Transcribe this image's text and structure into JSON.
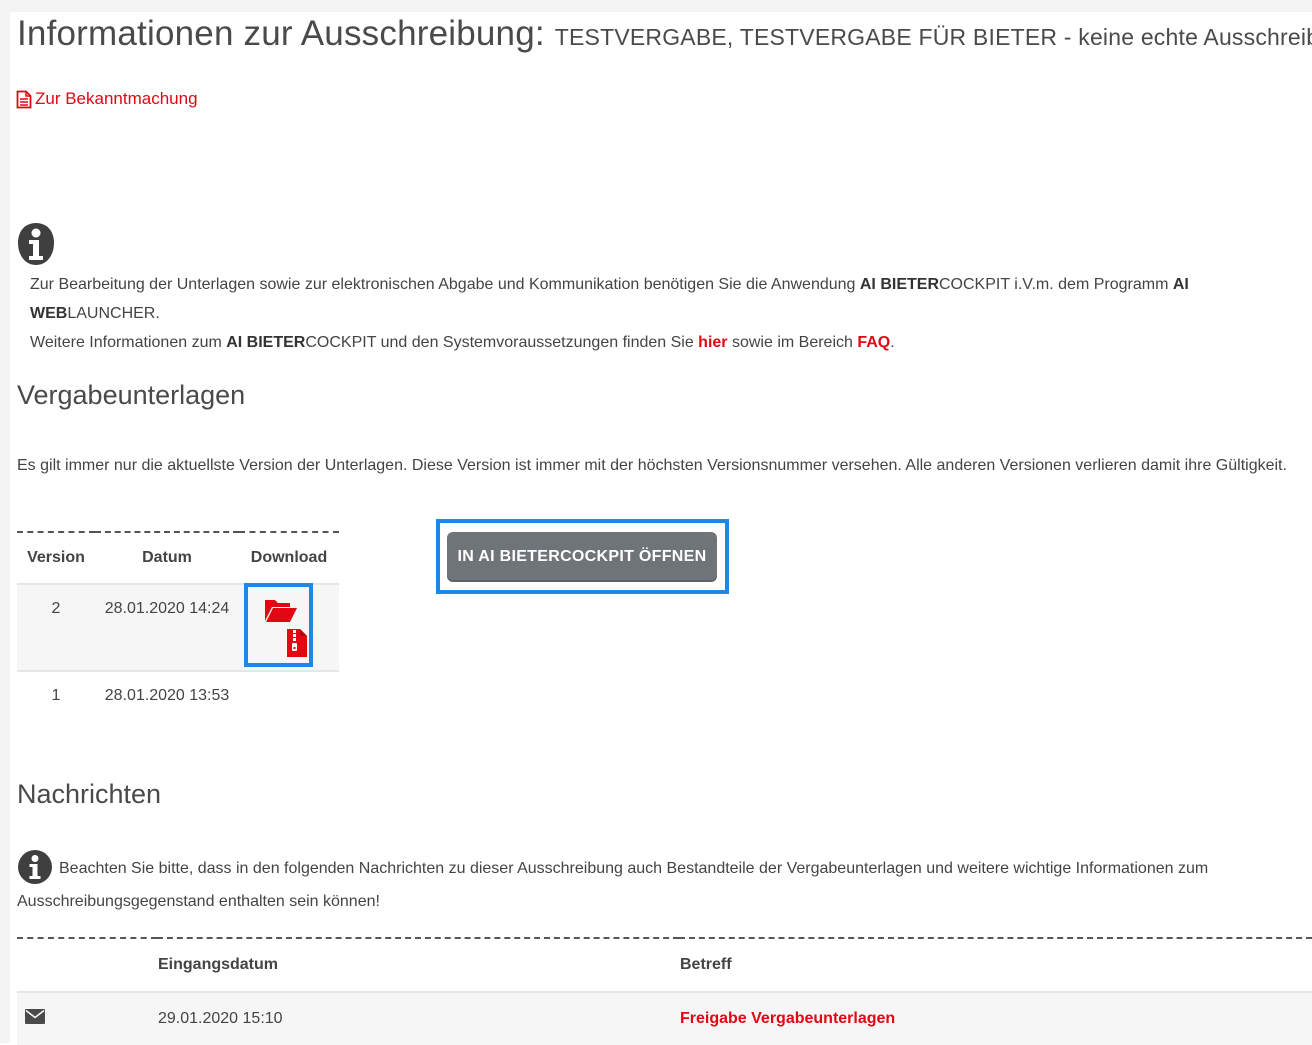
{
  "header": {
    "title": "Informationen zur Ausschreibung:",
    "subtitle": "TESTVERGABE, TESTVERGABE FÜR BIETER - keine echte Ausschreibung!"
  },
  "announcement_link": {
    "label": "Zur Bekanntmachung",
    "icon": "document-icon"
  },
  "info": {
    "icon": "info-icon",
    "p1_a": "Zur Bearbeitung der Unterlagen sowie zur elektronischen Abgabe und Kommunikation benötigen Sie die Anwendung ",
    "p1_ai1": "AI BIETER",
    "p1_cockpit": "COCKPIT",
    "p1_b": " i.V.m. dem Programm ",
    "p1_ai2": "AI WEB",
    "p1_launcher": "LAUNCHER",
    "p1_end": ".",
    "p2_a": "Weitere Informationen zum ",
    "p2_ai": "AI BIETER",
    "p2_cockpit": "COCKPIT",
    "p2_b": " und den Systemvoraussetzungen finden Sie ",
    "p2_link_hier": "hier",
    "p2_c": " sowie im Bereich ",
    "p2_link_faq": "FAQ",
    "p2_end": "."
  },
  "vergabe": {
    "heading": "Vergabeunterlagen",
    "note": "Es gilt immer nur die aktuellste Version der Unterlagen. Diese Version ist immer mit der höchsten Versionsnummer versehen. Alle anderen Versionen verlieren damit ihre Gültigkeit.",
    "columns": [
      "Version",
      "Datum",
      "Download"
    ],
    "rows": [
      {
        "version": "2",
        "datum": "28.01.2020 14:24",
        "download_icons": [
          "folder-open-icon",
          "zip-file-icon"
        ]
      },
      {
        "version": "1",
        "datum": "28.01.2020 13:53",
        "download_icons": []
      }
    ],
    "button_label": "IN AI BIETERCOCKPIT ÖFFNEN",
    "colors": {
      "accent": "#e30613",
      "button": "#6f7479",
      "highlight": "#1e88e5"
    }
  },
  "nachrichten": {
    "heading": "Nachrichten",
    "note": "Beachten Sie bitte, dass in den folgenden Nachrichten zu dieser Ausschreibung auch Bestandteile der Vergabeunterlagen und weitere wichtige Informationen zum Ausschreibungsgegenstand enthalten sein können!",
    "columns": [
      "",
      "Eingangsdatum",
      "Betreff"
    ],
    "rows": [
      {
        "icon": "envelope-icon",
        "date": "29.01.2020 15:10",
        "subject": "Freigabe Vergabeunterlagen"
      }
    ]
  }
}
